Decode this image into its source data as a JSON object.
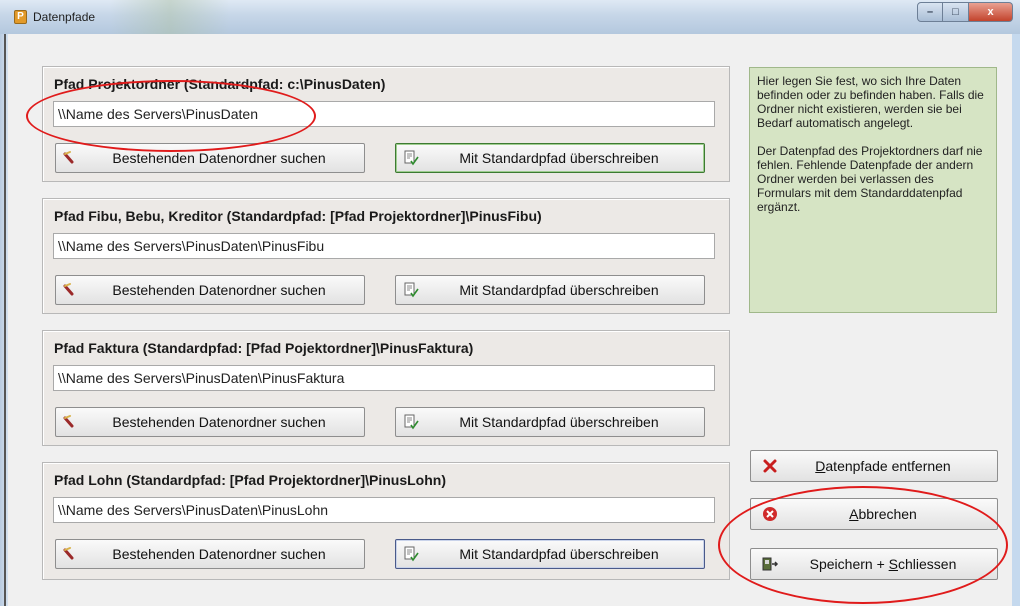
{
  "window": {
    "title": "Datenpfade",
    "icon_letter": "P",
    "controls": {
      "minimize": "–",
      "maximize": "□",
      "close": "x"
    }
  },
  "groups": [
    {
      "title": "Pfad Projektordner (Standardpfad: c:\\PinusDaten)",
      "value": "\\\\Name des Servers\\PinusDaten",
      "search_label": "Bestehenden Datenordner suchen",
      "std_label": "Mit Standardpfad überschreiben"
    },
    {
      "title": "Pfad Fibu, Bebu, Kreditor (Standardpfad: [Pfad Projektordner]\\PinusFibu)",
      "value": "\\\\Name des Servers\\PinusDaten\\PinusFibu",
      "search_label": "Bestehenden Datenordner suchen",
      "std_label": "Mit Standardpfad überschreiben"
    },
    {
      "title": "Pfad Faktura (Standardpfad: [Pfad Pojektordner]\\PinusFaktura)",
      "value": "\\\\Name des Servers\\PinusDaten\\PinusFaktura",
      "search_label": "Bestehenden Datenordner suchen",
      "std_label": "Mit Standardpfad überschreiben"
    },
    {
      "title": "Pfad Lohn (Standardpfad: [Pfad Projektordner]\\PinusLohn)",
      "value": "\\\\Name des Servers\\PinusDaten\\PinusLohn",
      "search_label": "Bestehenden Datenordner suchen",
      "std_label": "Mit Standardpfad überschreiben"
    }
  ],
  "help": {
    "paragraph1": "Hier legen Sie fest, wo sich Ihre Daten befinden oder zu befinden haben. Falls die Ordner nicht existieren, werden sie bei Bedarf automatisch angelegt.",
    "paragraph2": "Der Datenpfad des Projektordners darf nie fehlen. Fehlende Datenpfade der andern Ordner werden bei verlassen des Formulars mit dem Standarddatenpfad ergänzt."
  },
  "actions": {
    "remove": {
      "pre": "",
      "ul": "D",
      "post": "atenpfade entfernen"
    },
    "cancel": {
      "pre": "",
      "ul": "A",
      "post": "bbrechen"
    },
    "save": {
      "pre": "Speichern + ",
      "ul": "S",
      "post": "chliessen"
    }
  },
  "icons": {
    "folder_search": "folder-search-icon",
    "doc_check": "document-check-icon",
    "remove": "red-x-icon",
    "cancel": "red-circle-x-icon",
    "save": "save-close-icon"
  },
  "colors": {
    "help_bg": "#d6e4c4",
    "annotation": "#e01b1b",
    "focus_border": "#3d7a32"
  }
}
